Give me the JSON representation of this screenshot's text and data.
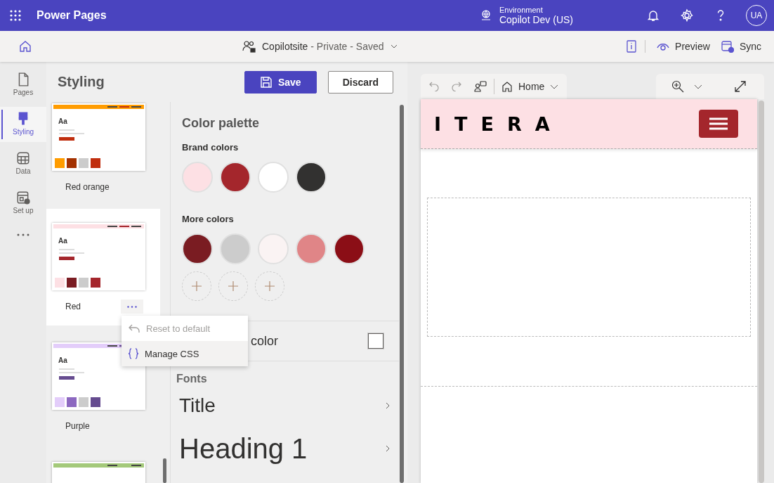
{
  "top_bar": {
    "app_name": "Power Pages",
    "environment_label": "Environment",
    "environment_name": "Copilot Dev (US)",
    "avatar": "UA"
  },
  "command_bar": {
    "site": "Copilotsite",
    "status": "- Private - Saved",
    "actions": [
      {
        "label": "Preview",
        "kind": "preview"
      },
      {
        "label": "Sync",
        "kind": "sync"
      }
    ]
  },
  "rail": [
    {
      "label": "Pages",
      "kind": "pages",
      "selected": false
    },
    {
      "label": "Styling",
      "kind": "styling",
      "selected": true
    },
    {
      "label": "Data",
      "kind": "data",
      "selected": false
    },
    {
      "label": "Set up",
      "kind": "setup",
      "selected": false
    }
  ],
  "styling": {
    "title": "Styling",
    "buttons": [
      {
        "label": "Save",
        "kind": "primary"
      },
      {
        "label": "Discard",
        "kind": "secondary"
      }
    ],
    "themes": [
      {
        "name": "Red orange",
        "sample_text": "Aa",
        "selected": false,
        "color": "#ff9c00",
        "swatches": [
          {
            "color": "#ff9c00"
          },
          {
            "color": "#a33100"
          },
          {
            "color": "#cccccc"
          },
          {
            "color": "#c02e0e"
          }
        ]
      },
      {
        "name": "Red",
        "sample_text": "Aa",
        "selected": true,
        "color": "#fde0e4",
        "swatches": [
          {
            "color": "#fde0e4"
          },
          {
            "color": "#7a1c22"
          },
          {
            "color": "#cccccc"
          },
          {
            "color": "#a4262c"
          }
        ]
      },
      {
        "name": "Purple",
        "sample_text": "Aa",
        "selected": false,
        "color": "#e3cdfa",
        "swatches": [
          {
            "color": "#e3cdfa"
          },
          {
            "color": "#8c68c0"
          },
          {
            "color": "#cccccc"
          },
          {
            "color": "#654b8f"
          }
        ]
      },
      {
        "selected": false,
        "color": "#a4c97a"
      }
    ],
    "theme_menu": [
      {
        "label": "Reset to default",
        "kind": "undo",
        "disabled": true,
        "highlighted": false
      },
      {
        "label": "Manage CSS",
        "kind": "braces",
        "disabled": false,
        "highlighted": true
      }
    ],
    "color_palette": {
      "title": "Color palette",
      "brand_label": "Brand colors",
      "brand_colors": [
        {
          "color": "#fde0e4"
        },
        {
          "color": "#a4262c"
        },
        {
          "color": "#ffffff"
        },
        {
          "color": "#323130"
        }
      ],
      "more_label": "More colors",
      "more_colors": [
        {
          "color": "#7a1c22"
        },
        {
          "color": "#cccccc"
        },
        {
          "color": "#faf3f3"
        },
        {
          "color": "#e08587"
        },
        {
          "color": "#8b0e16"
        }
      ],
      "add_buttons": [
        {
          "kind": "add"
        },
        {
          "kind": "add"
        },
        {
          "kind": "add"
        }
      ]
    },
    "background_color": {
      "label": "color",
      "checked": false
    },
    "fonts": {
      "title": "Fonts",
      "items": [
        {
          "label": "Title",
          "kind": "title"
        },
        {
          "label": "Heading 1",
          "kind": "heading1"
        }
      ]
    }
  },
  "preview": {
    "page": "Home",
    "logo": "ITERA"
  }
}
